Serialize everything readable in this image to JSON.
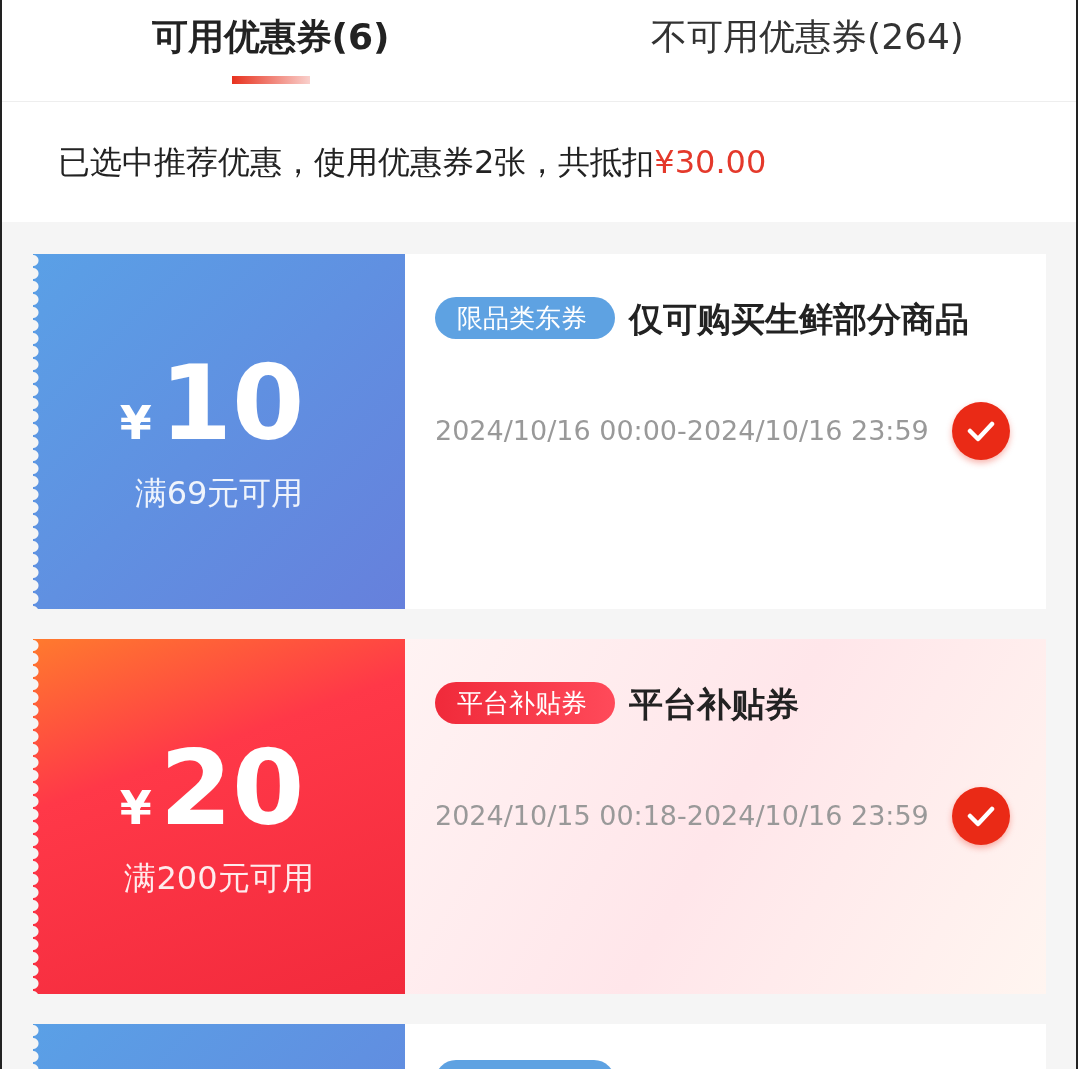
{
  "tabs": [
    {
      "label": "可用优惠券(6)",
      "selected": true
    },
    {
      "label": "不可用优惠券(264)",
      "selected": false
    }
  ],
  "summary": "已选中推荐优惠，使用优惠券2张，共抵扣",
  "summary_amount": "¥30.00",
  "coupons": [
    {
      "kind": "category",
      "currency": "¥",
      "amount": "10",
      "condition": "满69元可用",
      "tag": "限品类东券",
      "title": "仅可购买生鲜部分商品",
      "validity": "2024/10/16 00:00-2024/10/16 23:59",
      "checked": true
    },
    {
      "kind": "platform",
      "currency": "¥",
      "amount": "20",
      "condition": "满200元可用",
      "tag": "平台补贴券",
      "title": "平台补贴券",
      "validity": "2024/10/15 00:18-2024/10/16 23:59",
      "checked": true
    },
    {
      "kind": "category"
    }
  ]
}
